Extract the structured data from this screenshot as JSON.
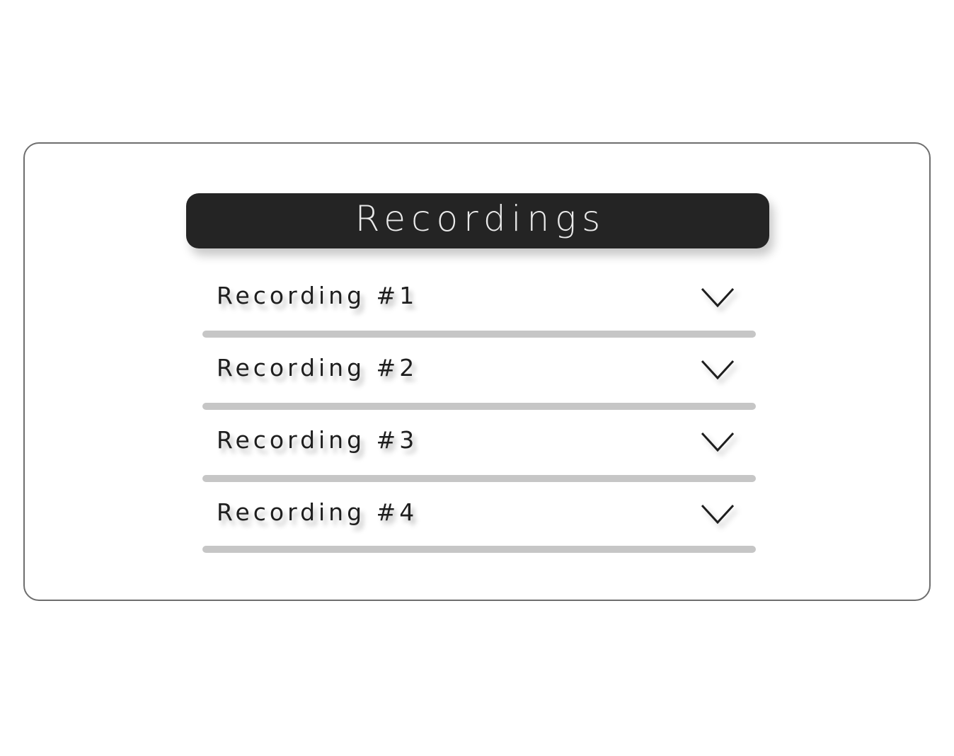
{
  "panel": {
    "title": "Recordings",
    "items": [
      {
        "label": "Recording #1",
        "icon": "chevron-down-icon"
      },
      {
        "label": "Recording #2",
        "icon": "chevron-down-icon"
      },
      {
        "label": "Recording #3",
        "icon": "chevron-down-icon"
      },
      {
        "label": "Recording #4",
        "icon": "chevron-down-icon"
      }
    ]
  },
  "colors": {
    "header_background": "#242424",
    "header_text": "#e9e9e9",
    "item_text": "#1e1e1e",
    "divider": "#c6c6c6",
    "card_border": "#6e6e6e"
  }
}
